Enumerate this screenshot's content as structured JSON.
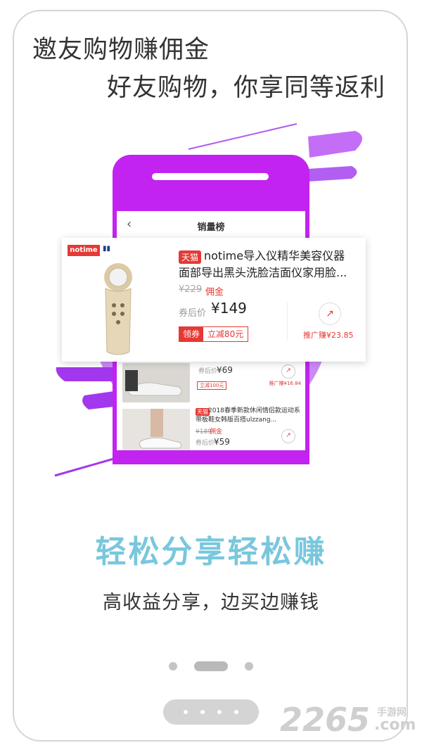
{
  "header": {
    "line1": "邀友购物赚佣金",
    "line2": "好友购物，你享同等返利"
  },
  "phone": {
    "title": "销量榜",
    "back_icon": "chevron-left-icon"
  },
  "featured_product": {
    "brand": "notime",
    "platform_badge": "天猫",
    "title": "notime导入仪精华美容仪器面部导出黑头洗脸洁面仪家用脸...",
    "original_price": "¥229",
    "commission_label": "佣金",
    "after_coupon_label": "券后价",
    "after_coupon_price": "¥149",
    "coupon_label": "领券",
    "coupon_value": "立减80元",
    "share_label": "推广赚¥23.85"
  },
  "list_items": [
    {
      "after_coupon_label": "券后价",
      "price": "¥69",
      "coupon": "立减100元",
      "share_label": "推广赚¥16.84"
    },
    {
      "platform_badge": "天猫",
      "title": "2018春季新款休闲情侣款运动系带板鞋女韩版百搭ulzzang...",
      "original_price": "¥189",
      "commission_label": "佣金",
      "after_coupon_label": "券后价",
      "price": "¥59"
    }
  ],
  "promo": {
    "tagline": "轻松分享轻松赚",
    "subline": "高收益分享，边买边赚钱"
  },
  "pagination": {
    "current_page": 2,
    "total_pages": 3
  },
  "watermark": {
    "number": "2265",
    "site": "手游网",
    "domain": ".com"
  },
  "colors": {
    "phone_purple": "#c223f0",
    "accent_red": "#e53935",
    "tagline_blue": "#79c7dd"
  }
}
